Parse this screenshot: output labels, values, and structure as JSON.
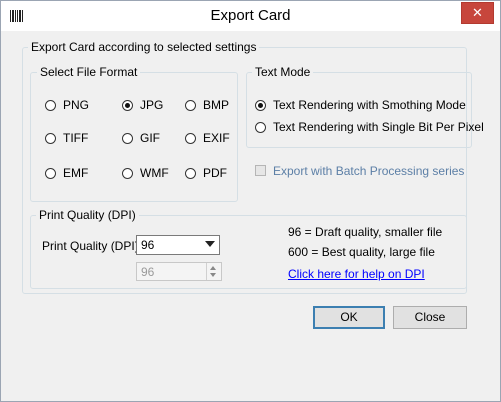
{
  "window": {
    "title": "Export Card",
    "close_glyph": "✕"
  },
  "main_group": {
    "legend": "Export Card according to selected settings"
  },
  "file_format": {
    "legend": "Select File Format",
    "options": [
      {
        "label": "PNG",
        "checked": false
      },
      {
        "label": "JPG",
        "checked": true
      },
      {
        "label": "BMP",
        "checked": false
      },
      {
        "label": "TIFF",
        "checked": false
      },
      {
        "label": "GIF",
        "checked": false
      },
      {
        "label": "EXIF",
        "checked": false
      },
      {
        "label": "EMF",
        "checked": false
      },
      {
        "label": "WMF",
        "checked": false
      },
      {
        "label": "PDF",
        "checked": false
      }
    ]
  },
  "text_mode": {
    "legend": "Text Mode",
    "options": [
      {
        "label": "Text Rendering with Smothing Mode",
        "checked": true
      },
      {
        "label": "Text Rendering with Single Bit Per Pixel",
        "checked": false
      }
    ]
  },
  "batch": {
    "label": "Export with Batch Processing series",
    "checked": false,
    "enabled": false
  },
  "print_quality": {
    "legend": "Print Quality (DPI)",
    "label": "Print Quality (DPI) :",
    "selected": "96",
    "spin_value": "96",
    "hint_low": "96 = Draft quality, smaller file",
    "hint_high": "600  = Best quality, large file",
    "help_link": "Click here for help on DPI"
  },
  "buttons": {
    "ok": "OK",
    "close": "Close"
  }
}
